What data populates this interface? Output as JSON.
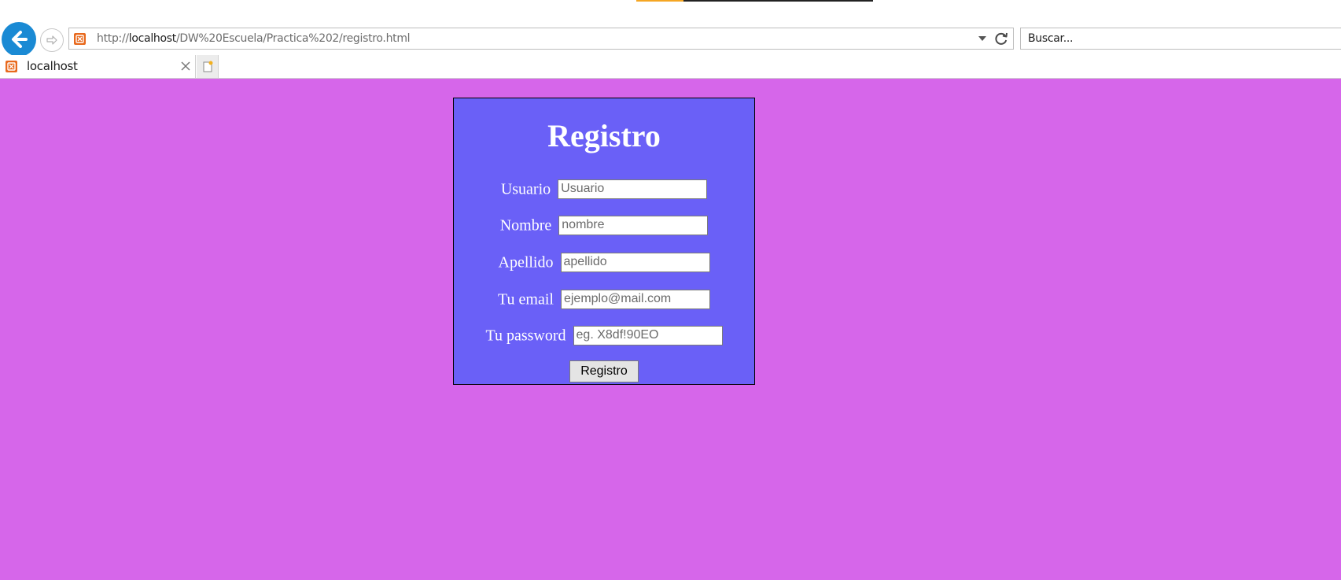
{
  "browser": {
    "url_prefix": "http://",
    "url_host": "localhost",
    "url_path": "/DW%20Escuela/Practica%202/registro.html",
    "search_placeholder": "Buscar...",
    "tab_title": "localhost",
    "accent_color": "#1a8ad4"
  },
  "page": {
    "background_color": "#d666ea",
    "form": {
      "background_color": "#6a60f7",
      "title": "Registro",
      "fields": [
        {
          "label": "Usuario",
          "placeholder": "Usuario"
        },
        {
          "label": "Nombre",
          "placeholder": "nombre"
        },
        {
          "label": "Apellido",
          "placeholder": "apellido"
        },
        {
          "label": "Tu email",
          "placeholder": "ejemplo@mail.com"
        },
        {
          "label": "Tu password",
          "placeholder": "eg. X8df!90EO"
        }
      ],
      "submit_label": "Registro"
    }
  }
}
